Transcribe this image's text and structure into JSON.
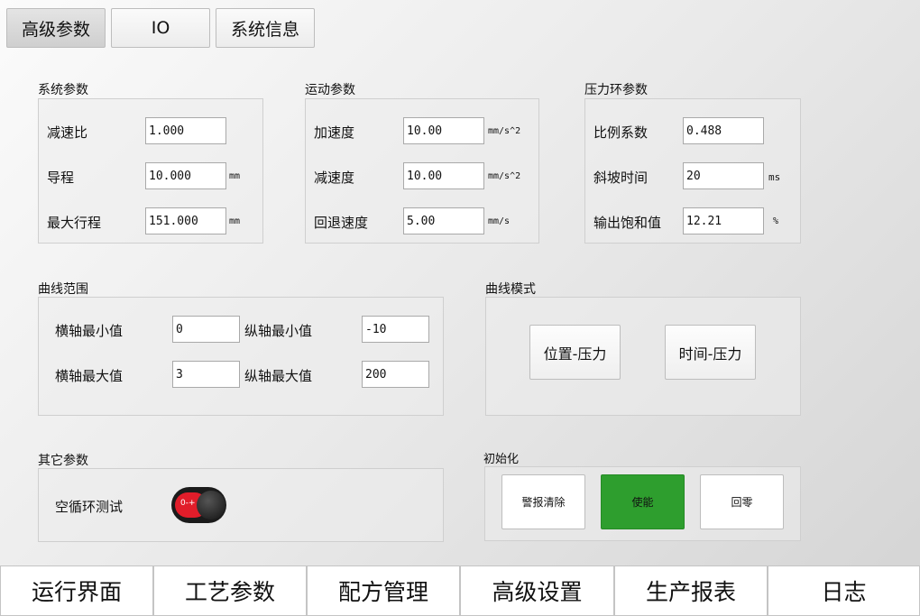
{
  "tabs": [
    "高级参数",
    "IO",
    "系统信息"
  ],
  "system": {
    "title": "系统参数",
    "rows": [
      {
        "label": "减速比",
        "value": "1.000",
        "unit": ""
      },
      {
        "label": "导程",
        "value": "10.000",
        "unit": "mm"
      },
      {
        "label": "最大行程",
        "value": "151.000",
        "unit": "mm"
      }
    ]
  },
  "motion": {
    "title": "运动参数",
    "rows": [
      {
        "label": "加速度",
        "value": "10.00",
        "unit": "mm/s^2"
      },
      {
        "label": "减速度",
        "value": "10.00",
        "unit": "mm/s^2"
      },
      {
        "label": "回退速度",
        "value": "5.00",
        "unit": "mm/s"
      }
    ]
  },
  "pressure": {
    "title": "压力环参数",
    "rows": [
      {
        "label": "比例系数",
        "value": "0.488",
        "unit": ""
      },
      {
        "label": "斜坡时间",
        "value": "20",
        "unit": "ms"
      },
      {
        "label": "输出饱和值",
        "value": "12.21",
        "unit": "%"
      }
    ]
  },
  "curve_range": {
    "title": "曲线范围",
    "x_min_label": "横轴最小值",
    "x_min": "0",
    "x_max_label": "横轴最大值",
    "x_max": "3",
    "y_min_label": "纵轴最小值",
    "y_min": "-10",
    "y_max_label": "纵轴最大值",
    "y_max": "200"
  },
  "curve_mode": {
    "title": "曲线模式",
    "pos_pressure": "位置-压力",
    "time_pressure": "时间-压力"
  },
  "other": {
    "title": "其它参数",
    "idle_test_label": "空循环测试",
    "toggle_text": "0-+",
    "toggle_color": "#e11d2a"
  },
  "init": {
    "title": "初始化",
    "alarm_clear": "警报清除",
    "enable": "使能",
    "enable_color": "#2e9e2e",
    "home": "回零"
  },
  "nav": [
    "运行界面",
    "工艺参数",
    "配方管理",
    "高级设置",
    "生产报表",
    "日志"
  ]
}
